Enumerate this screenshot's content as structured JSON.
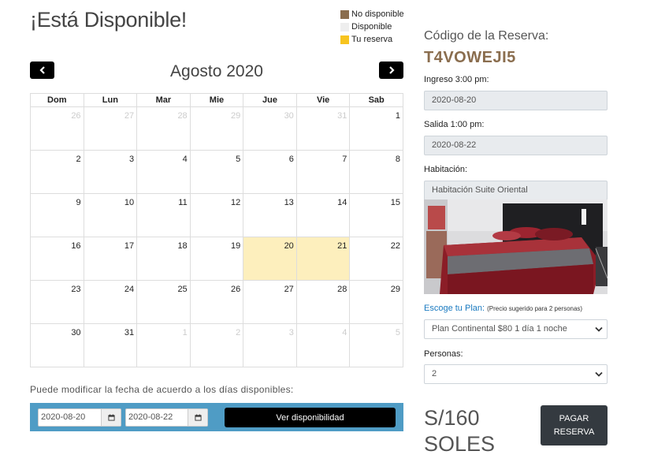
{
  "page": {
    "title": "¡Está Disponible!"
  },
  "legend": {
    "items": [
      {
        "label": "No disponible",
        "color": "#8a6d4e"
      },
      {
        "label": "Disponible",
        "color": "#eeeeee"
      },
      {
        "label": "Tu reserva",
        "color": "#f7c41f"
      }
    ]
  },
  "calendar": {
    "month_title": "Agosto 2020",
    "weekdays": [
      "Dom",
      "Lun",
      "Mar",
      "Mie",
      "Jue",
      "Vie",
      "Sab"
    ],
    "weeks": [
      [
        "26",
        "27",
        "28",
        "29",
        "30",
        "31",
        "1"
      ],
      [
        "2",
        "3",
        "4",
        "5",
        "6",
        "7",
        "8"
      ],
      [
        "9",
        "10",
        "11",
        "12",
        "13",
        "14",
        "15"
      ],
      [
        "16",
        "17",
        "18",
        "19",
        "20",
        "21",
        "22"
      ],
      [
        "23",
        "24",
        "25",
        "26",
        "27",
        "28",
        "29"
      ],
      [
        "30",
        "31",
        "1",
        "2",
        "3",
        "4",
        "5"
      ]
    ],
    "reserved_days": [
      "20",
      "21"
    ],
    "reserved_color": "#fdefbd"
  },
  "hint": "Puede modificar la fecha de acuerdo a los días disponibles:",
  "date_bar": {
    "start_value": "2020-08-20",
    "end_value": "2020-08-22",
    "check_button": "Ver disponibilidad",
    "bg_color": "#4f9cc5"
  },
  "reservation": {
    "code_label": "Código de la Reserva:",
    "code_value": "T4VOWEJI5",
    "checkin_label": "Ingreso 3:00 pm:",
    "checkin_value": "2020-08-20",
    "checkout_label": "Salida 1:00 pm:",
    "checkout_value": "2020-08-22",
    "room_label": "Habitación:",
    "room_value": "Habitación Suite Oriental",
    "plan_label": "Escoge tu Plan:",
    "plan_note": "(Precio sugerido para 2 personas)",
    "plan_value": "Plan Continental $80 1 día 1 noche",
    "persons_label": "Personas:",
    "persons_value": "2"
  },
  "price": {
    "amount": "S/160",
    "currency": "SOLES"
  },
  "pay_button": {
    "line1": "PAGAR",
    "line2": "RESERVA"
  }
}
